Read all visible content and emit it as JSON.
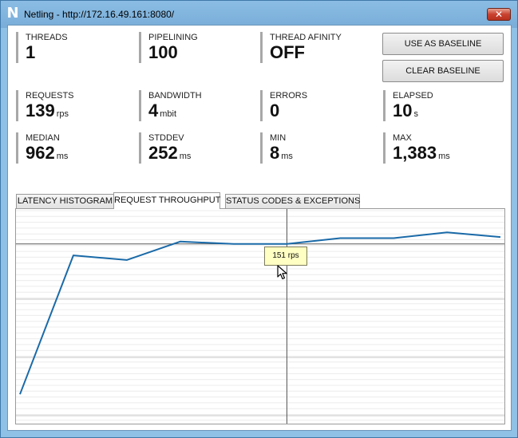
{
  "window": {
    "title": "Netling - http://172.16.49.161:8080/",
    "app_icon_glyph": "N",
    "close_glyph": "✕",
    "accent_color": "#7db3dc"
  },
  "metrics": {
    "threads": {
      "label": "THREADS",
      "value": "1",
      "unit": ""
    },
    "pipelining": {
      "label": "PIPELINING",
      "value": "100",
      "unit": ""
    },
    "thread_affinity": {
      "label": "THREAD AFINITY",
      "value": "OFF",
      "unit": ""
    },
    "requests": {
      "label": "REQUESTS",
      "value": "139",
      "unit": "rps"
    },
    "bandwidth": {
      "label": "BANDWIDTH",
      "value": "4",
      "unit": "mbit"
    },
    "errors": {
      "label": "ERRORS",
      "value": "0",
      "unit": ""
    },
    "elapsed": {
      "label": "ELAPSED",
      "value": "10",
      "unit": "s"
    },
    "median": {
      "label": "MEDIAN",
      "value": "962",
      "unit": "ms"
    },
    "stddev": {
      "label": "STDDEV",
      "value": "252",
      "unit": "ms"
    },
    "min": {
      "label": "MIN",
      "value": "8",
      "unit": "ms"
    },
    "max": {
      "label": "MAX",
      "value": "1,383",
      "unit": "ms"
    }
  },
  "buttons": {
    "use_as_baseline": "USE AS BASELINE",
    "clear_baseline": "CLEAR BASELINE"
  },
  "tabs": [
    {
      "label": "LATENCY HISTOGRAM",
      "active": false
    },
    {
      "label": "REQUEST THROUGHPUT",
      "active": true
    },
    {
      "label": "STATUS CODES & EXCEPTIONS",
      "active": false
    }
  ],
  "tooltip": {
    "text": "151 rps"
  },
  "chart_data": {
    "type": "line",
    "title": "",
    "xlabel": "",
    "ylabel": "",
    "x": [
      1,
      2,
      3,
      4,
      5,
      6,
      7,
      8,
      9,
      10
    ],
    "series": [
      {
        "values": [
          20,
          141,
          137,
          153,
          151,
          151,
          156,
          156,
          161,
          157
        ]
      }
    ],
    "baseline": 151,
    "ylim": [
      0,
      180
    ],
    "grid": true,
    "line_color": "#1a6aa8",
    "hover_x": 6
  }
}
